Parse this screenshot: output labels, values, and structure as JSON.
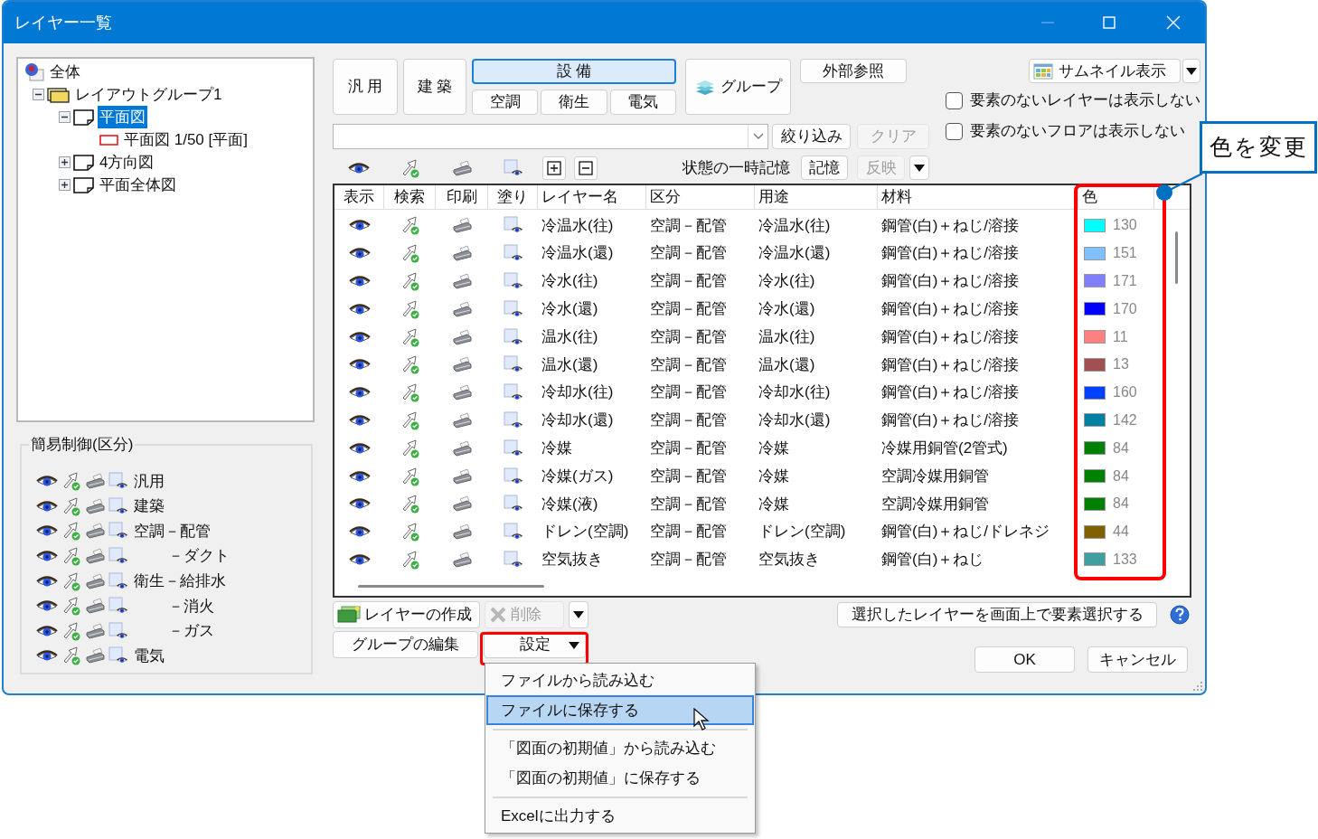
{
  "window": {
    "title": "レイヤー一覧"
  },
  "tree": [
    {
      "label": "全体",
      "kind": "root",
      "selected": false,
      "children": [
        {
          "label": "レイアウトグループ1",
          "kind": "group",
          "selected": false,
          "expanded": true,
          "children": [
            {
              "label": "平面図",
              "kind": "drawing",
              "selected": true,
              "expanded": true,
              "children": [
                {
                  "label": "平面図 1/50 [平面]",
                  "kind": "view",
                  "selected": false
                }
              ]
            },
            {
              "label": "4方向図",
              "kind": "drawing",
              "selected": false,
              "expanded": false
            },
            {
              "label": "平面全体図",
              "kind": "drawing",
              "selected": false,
              "expanded": false
            }
          ]
        }
      ]
    }
  ],
  "simple_control": {
    "title": "簡易制御(区分)",
    "rows": [
      {
        "label": "汎用",
        "kind": "main"
      },
      {
        "label": "建築",
        "kind": "main"
      },
      {
        "label": "空調－配管",
        "kind": "main"
      },
      {
        "label": "－ダクト",
        "kind": "sub"
      },
      {
        "label": "衛生－給排水",
        "kind": "main"
      },
      {
        "label": "－消火",
        "kind": "sub"
      },
      {
        "label": "－ガス",
        "kind": "sub"
      },
      {
        "label": "電気",
        "kind": "main"
      }
    ]
  },
  "category_buttons": [
    {
      "label": "汎 用",
      "selected": false
    },
    {
      "label": "建 築",
      "selected": false
    },
    {
      "label": "設 備",
      "selected": true
    }
  ],
  "equipment_sub_buttons": [
    "空調",
    "衛生",
    "電気"
  ],
  "group_button": "グループ",
  "external_reference_button": "外部参照",
  "thumbnail_view": "サムネイル表示",
  "checkboxes": [
    {
      "label": "要素のないレイヤーは表示しない",
      "checked": false
    },
    {
      "label": "要素のないフロアは表示しない",
      "checked": false
    }
  ],
  "filter_button": {
    "label": "絞り込み",
    "disabled": false
  },
  "clear_button": {
    "label": "クリア",
    "disabled": true
  },
  "state_memory": {
    "label": "状態の一時記憶",
    "memory_button": {
      "label": "記憶",
      "disabled": false
    },
    "apply_button": {
      "label": "反映",
      "disabled": true
    }
  },
  "table": {
    "columns": [
      "表示",
      "検索",
      "印刷",
      "塗り",
      "レイヤー名",
      "区分",
      "用途",
      "材料",
      "色"
    ],
    "rows": [
      {
        "layer_name": "冷温水(往)",
        "category": "空調－配管",
        "usage": "冷温水(往)",
        "material": "鋼管(白)＋ねじ/溶接",
        "color": "#00ffff",
        "color_number": "130"
      },
      {
        "layer_name": "冷温水(還)",
        "category": "空調－配管",
        "usage": "冷温水(還)",
        "material": "鋼管(白)＋ねじ/溶接",
        "color": "#80c0ff",
        "color_number": "151"
      },
      {
        "layer_name": "冷水(往)",
        "category": "空調－配管",
        "usage": "冷水(往)",
        "material": "鋼管(白)＋ねじ/溶接",
        "color": "#8080ff",
        "color_number": "171"
      },
      {
        "layer_name": "冷水(還)",
        "category": "空調－配管",
        "usage": "冷水(還)",
        "material": "鋼管(白)＋ねじ/溶接",
        "color": "#0000ff",
        "color_number": "170"
      },
      {
        "layer_name": "温水(往)",
        "category": "空調－配管",
        "usage": "温水(往)",
        "material": "鋼管(白)＋ねじ/溶接",
        "color": "#ff8080",
        "color_number": "11"
      },
      {
        "layer_name": "温水(還)",
        "category": "空調－配管",
        "usage": "温水(還)",
        "material": "鋼管(白)＋ねじ/溶接",
        "color": "#a05050",
        "color_number": "13"
      },
      {
        "layer_name": "冷却水(往)",
        "category": "空調－配管",
        "usage": "冷却水(往)",
        "material": "鋼管(白)＋ねじ/溶接",
        "color": "#0040ff",
        "color_number": "160"
      },
      {
        "layer_name": "冷却水(還)",
        "category": "空調－配管",
        "usage": "冷却水(還)",
        "material": "鋼管(白)＋ねじ/溶接",
        "color": "#0080a0",
        "color_number": "142"
      },
      {
        "layer_name": "冷媒",
        "category": "空調－配管",
        "usage": "冷媒",
        "material": "冷媒用銅管(2管式)",
        "color": "#008000",
        "color_number": "84"
      },
      {
        "layer_name": "冷媒(ガス)",
        "category": "空調－配管",
        "usage": "冷媒",
        "material": "空調冷媒用銅管",
        "color": "#008000",
        "color_number": "84"
      },
      {
        "layer_name": "冷媒(液)",
        "category": "空調－配管",
        "usage": "冷媒",
        "material": "空調冷媒用銅管",
        "color": "#008000",
        "color_number": "84"
      },
      {
        "layer_name": "ドレン(空調)",
        "category": "空調－配管",
        "usage": "ドレン(空調)",
        "material": "鋼管(白)＋ねじ/ドレネジ",
        "color": "#806000",
        "color_number": "44"
      },
      {
        "layer_name": "空気抜き",
        "category": "空調－配管",
        "usage": "空気抜き",
        "material": "鋼管(白)＋ねじ",
        "color": "#40a0a0",
        "color_number": "133"
      }
    ]
  },
  "create_layer_button": "レイヤーの作成",
  "delete_button": {
    "label": "削除",
    "disabled": true
  },
  "select_on_screen_button": "選択したレイヤーを画面上で要素選択する",
  "edit_group_button": "グループの編集",
  "settings_button": "設定",
  "settings_menu": [
    {
      "kind": "item",
      "label": "ファイルから読み込む",
      "selected": false
    },
    {
      "kind": "item",
      "label": "ファイルに保存する",
      "selected": true
    },
    {
      "kind": "separator"
    },
    {
      "kind": "item",
      "label": "「図面の初期値」から読み込む",
      "selected": false
    },
    {
      "kind": "item",
      "label": "「図面の初期値」に保存する",
      "selected": false
    },
    {
      "kind": "separator"
    },
    {
      "kind": "item",
      "label": "Excelに出力する",
      "selected": false
    }
  ],
  "ok_button": "OK",
  "cancel_button": "キャンセル",
  "callout": "色を変更"
}
